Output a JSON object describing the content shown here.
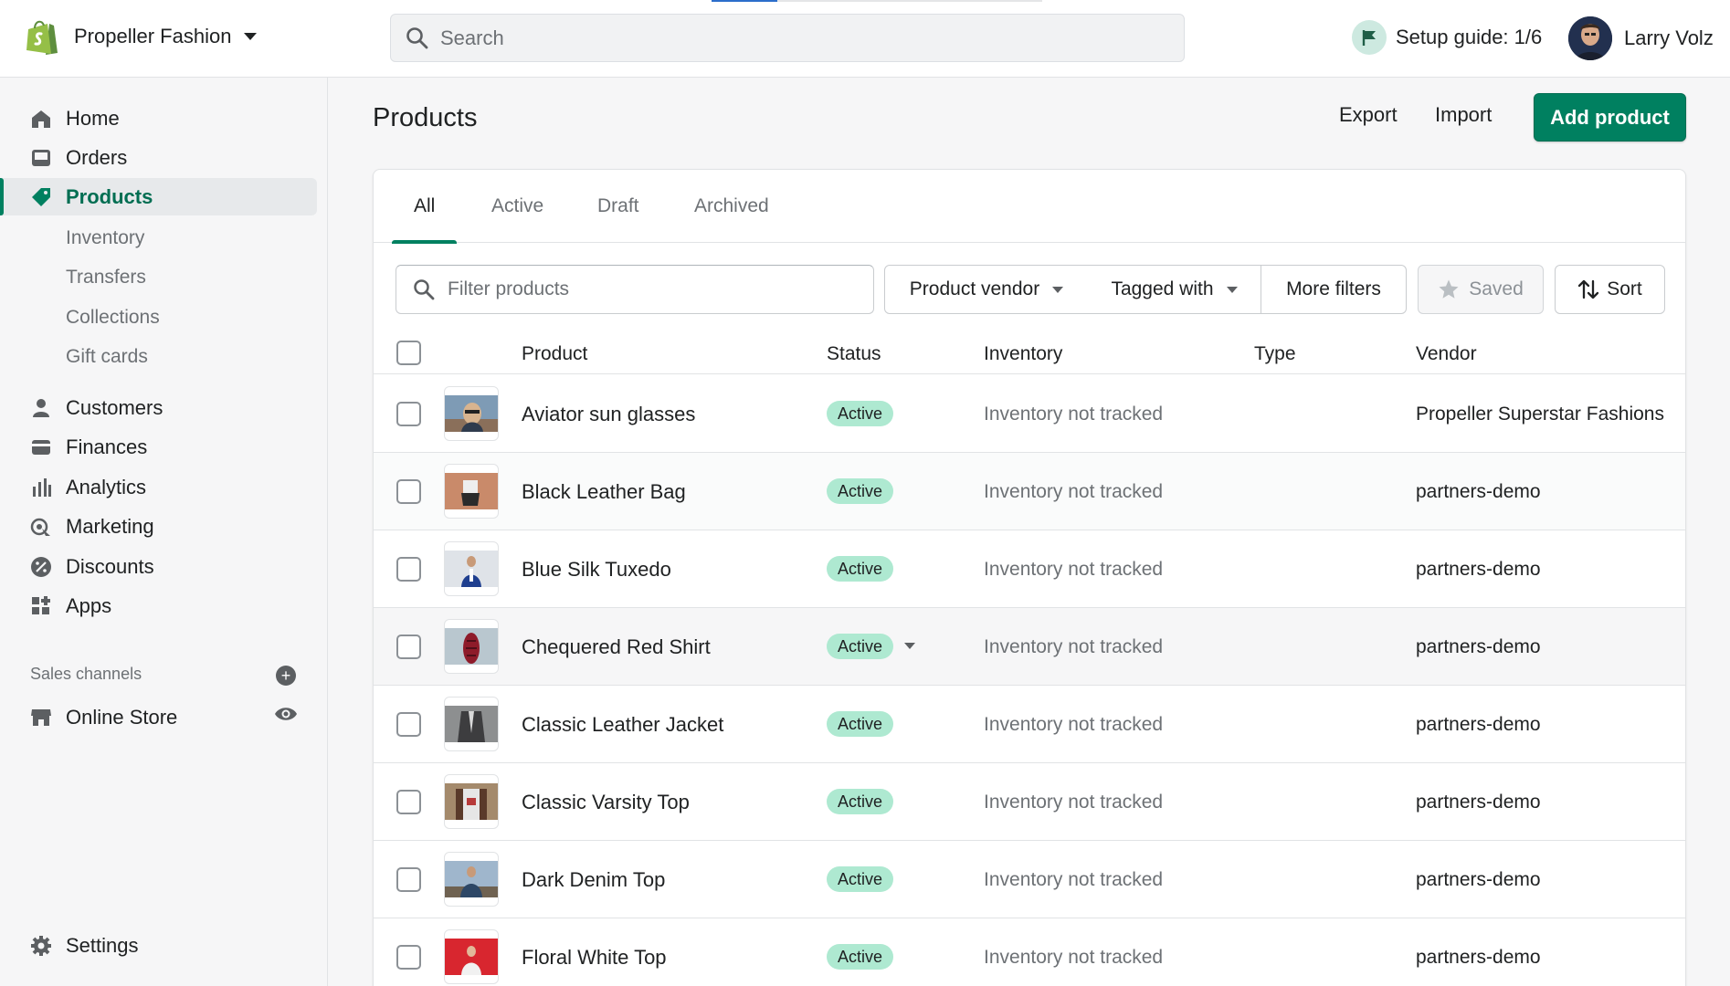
{
  "header": {
    "store_name": "Propeller Fashion",
    "search_placeholder": "Search",
    "setup_guide": "Setup guide: 1/6",
    "user_name": "Larry Volz"
  },
  "sidebar": {
    "items": [
      {
        "label": "Home",
        "icon": "home-icon"
      },
      {
        "label": "Orders",
        "icon": "orders-icon"
      },
      {
        "label": "Products",
        "icon": "tag-icon",
        "active": true
      },
      {
        "label": "Inventory"
      },
      {
        "label": "Transfers"
      },
      {
        "label": "Collections"
      },
      {
        "label": "Gift cards"
      },
      {
        "label": "Customers",
        "icon": "person-icon"
      },
      {
        "label": "Finances",
        "icon": "finances-icon"
      },
      {
        "label": "Analytics",
        "icon": "bar-chart-icon"
      },
      {
        "label": "Marketing",
        "icon": "marketing-icon"
      },
      {
        "label": "Discounts",
        "icon": "discount-icon"
      },
      {
        "label": "Apps",
        "icon": "apps-icon"
      }
    ],
    "sales_channels_label": "Sales channels",
    "online_store": "Online Store",
    "settings": "Settings"
  },
  "page": {
    "title": "Products",
    "export": "Export",
    "import": "Import",
    "add_product": "Add product"
  },
  "tabs": [
    "All",
    "Active",
    "Draft",
    "Archived"
  ],
  "filters": {
    "placeholder": "Filter products",
    "product_vendor": "Product vendor",
    "tagged_with": "Tagged with",
    "more_filters": "More filters",
    "saved": "Saved",
    "sort": "Sort"
  },
  "table": {
    "columns": [
      "Product",
      "Status",
      "Inventory",
      "Type",
      "Vendor"
    ],
    "rows": [
      {
        "name": "Aviator sun glasses",
        "status": "Active",
        "inventory": "Inventory not tracked",
        "type": "",
        "vendor": "Propeller Superstar Fashions"
      },
      {
        "name": "Black Leather Bag",
        "status": "Active",
        "inventory": "Inventory not tracked",
        "type": "",
        "vendor": "partners-demo"
      },
      {
        "name": "Blue Silk Tuxedo",
        "status": "Active",
        "inventory": "Inventory not tracked",
        "type": "",
        "vendor": "partners-demo"
      },
      {
        "name": "Chequered Red Shirt",
        "status": "Active",
        "inventory": "Inventory not tracked",
        "type": "",
        "vendor": "partners-demo"
      },
      {
        "name": "Classic Leather Jacket",
        "status": "Active",
        "inventory": "Inventory not tracked",
        "type": "",
        "vendor": "partners-demo"
      },
      {
        "name": "Classic Varsity Top",
        "status": "Active",
        "inventory": "Inventory not tracked",
        "type": "",
        "vendor": "partners-demo"
      },
      {
        "name": "Dark Denim Top",
        "status": "Active",
        "inventory": "Inventory not tracked",
        "type": "",
        "vendor": "partners-demo"
      },
      {
        "name": "Floral White Top",
        "status": "Active",
        "inventory": "Inventory not tracked",
        "type": "",
        "vendor": "partners-demo"
      }
    ]
  },
  "colors": {
    "brand_green": "#008060",
    "active_badge": "#aee9d1",
    "shopify_logo": "#95bf47"
  }
}
